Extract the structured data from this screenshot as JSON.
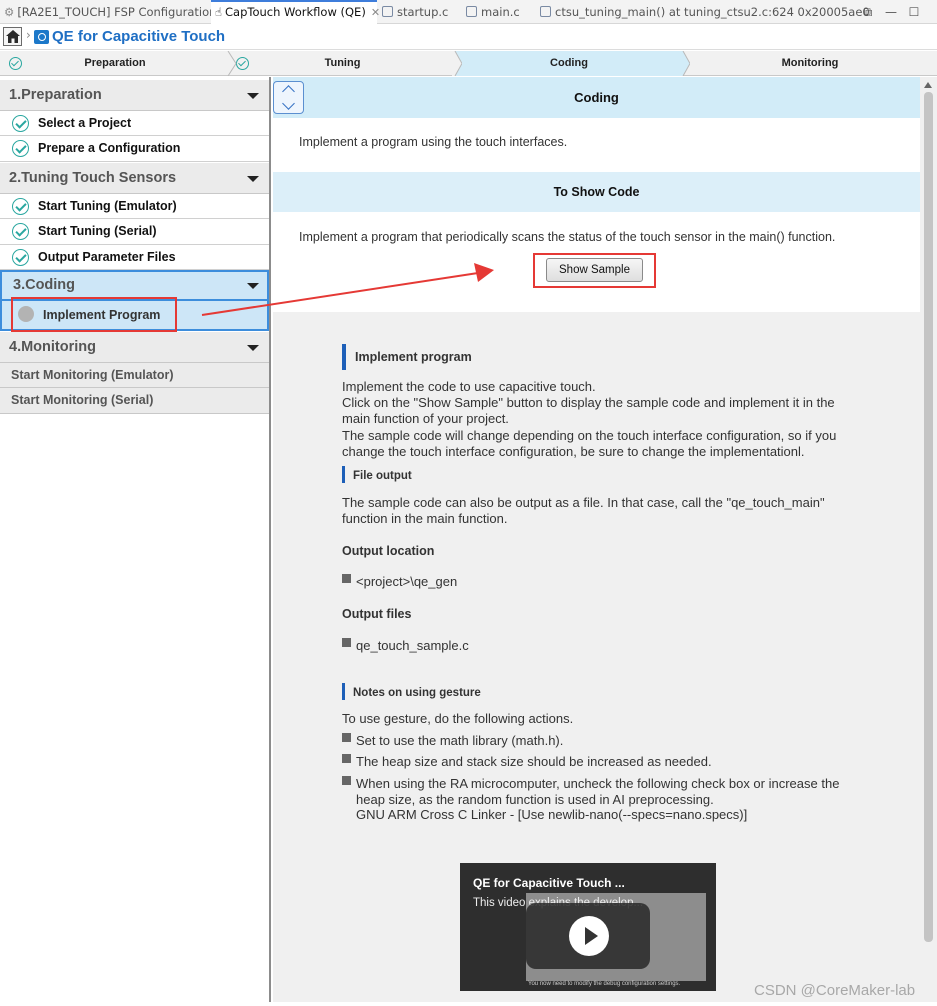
{
  "tabs": [
    {
      "label": "[RA2E1_TOUCH] FSP Configuration",
      "icon": "gear-icon",
      "active": false
    },
    {
      "label": "CapTouch Workflow (QE)",
      "icon": "touch-hand-icon",
      "active": true,
      "close": "✕"
    },
    {
      "label": "startup.c",
      "icon": "c-file-icon",
      "active": false
    },
    {
      "label": "main.c",
      "icon": "c-file-icon",
      "active": false
    },
    {
      "label": "ctsu_tuning_main() at tuning_ctsu2.c:624 0x20005ae0",
      "icon": "debug-frame-icon",
      "active": false
    }
  ],
  "breadcrumb": {
    "title": "QE for Capacitive Touch",
    "home_icon": "home-icon",
    "separator": "›"
  },
  "workflow_steps": [
    {
      "label": "Preparation",
      "done": true
    },
    {
      "label": "Tuning",
      "done": true
    },
    {
      "label": "Coding",
      "current": true
    },
    {
      "label": "Monitoring"
    }
  ],
  "nav": {
    "sections": [
      {
        "title": "1.Preparation",
        "items": [
          "Select a Project",
          "Prepare a Configuration"
        ]
      },
      {
        "title": "2.Tuning Touch Sensors",
        "items": [
          "Start Tuning (Emulator)",
          "Start Tuning (Serial)",
          "Output Parameter Files"
        ]
      },
      {
        "title": "3.Coding",
        "items": [
          "Implement Program"
        ]
      },
      {
        "title": "4.Monitoring",
        "items": [
          "Start Monitoring (Emulator)",
          "Start Monitoring (Serial)"
        ]
      }
    ]
  },
  "content": {
    "header": "Coding",
    "intro": "Implement a program using the touch interfaces.",
    "subheader": "To Show Code",
    "description": "Implement a program that periodically scans the status of the touch sensor in the main() function.",
    "show_sample_label": "Show Sample",
    "doc": {
      "title": "Implement program",
      "para": [
        "Implement the code to use capacitive touch.",
        "Click on the \"Show Sample\" button to display the sample code and implement it in the",
        "main function of your project.",
        "The sample code will change depending on the touch interface configuration, so if you",
        "change the touch interface configuration, be sure to change the implementationl."
      ],
      "file_output_title": "File output",
      "file_output_para": [
        "The sample code can also be output as a file. In that case, call the \"qe_touch_main\"",
        "function in the main function."
      ],
      "output_location_title": "Output location",
      "output_location": "<project>\\qe_gen",
      "output_files_title": "Output files",
      "output_file": "qe_touch_sample.c",
      "notes_title": "Notes on using gesture",
      "notes_intro": "To use gesture, do the following actions.",
      "notes": [
        [
          "Set to use the math library (math.h)."
        ],
        [
          "The heap size and stack size should be increased as needed."
        ],
        [
          "When using the RA microcomputer, uncheck the following check box or increase the",
          "heap size, as the random function is used in AI preprocessing.",
          "GNU ARM Cross C Linker - [Use newlib-nano(--specs=nano.specs)]"
        ]
      ]
    },
    "video": {
      "title": "QE for Capacitive Touch ...",
      "subtitle": "This video explains the develop...",
      "caption": "You now need to modify the debug configuration settings."
    }
  },
  "watermark": "CSDN @CoreMaker-lab",
  "colors": {
    "accent": "#1f6fc4",
    "step_current": "#d2ecf8",
    "annotation_red": "#e53935",
    "check_teal": "#2aa7a0"
  }
}
